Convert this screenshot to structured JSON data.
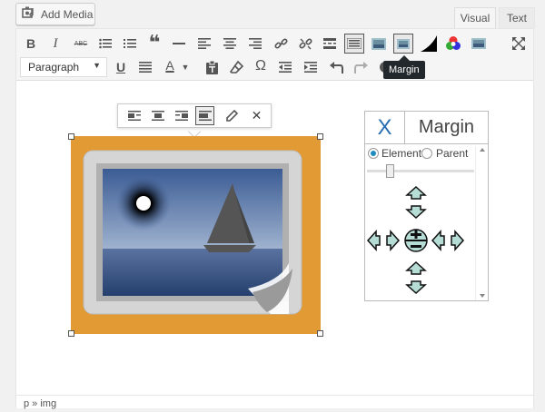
{
  "add_media": {
    "label": "Add Media",
    "icon": "camera-music-icon"
  },
  "tabs": {
    "visual": "Visual",
    "text": "Text"
  },
  "toolbar": {
    "row1": [
      "bold",
      "italic",
      "strikethrough",
      "bulleted-list",
      "numbered-list",
      "blockquote",
      "horizontal-line",
      "align-left",
      "align-center",
      "align-right",
      "insert-link",
      "remove-link",
      "read-more",
      "toolbar-toggle",
      "image-plugin",
      "margin",
      "shape",
      "color-picker",
      "image-plugin-2",
      "fullscreen"
    ],
    "row2": [
      "paragraph-format",
      "underline",
      "justify",
      "text-color",
      "paste-as-text",
      "clear-formatting",
      "special-character",
      "outdent",
      "indent",
      "undo",
      "redo",
      "help"
    ],
    "bold_label": "B",
    "italic_label": "I",
    "strike_label": "ABC",
    "quote_label": "❝",
    "underline_label": "U",
    "textcolor_label": "A",
    "special_char_label": "Ω"
  },
  "format_select": {
    "value": "Paragraph"
  },
  "tooltip": {
    "text": "Margin"
  },
  "image_toolbar": {
    "close_label": "✕"
  },
  "panel": {
    "close_label": "X",
    "title": "Margin",
    "radio_element": "Element",
    "radio_parent": "Parent",
    "selected": "Element"
  },
  "statusbar": {
    "path": "p » img"
  },
  "colors": {
    "image_background": "#e29a34",
    "tooltip_bg": "#23282d",
    "panel_close": "#2a6fb3",
    "arrow_fill": "#b6dcd6"
  }
}
